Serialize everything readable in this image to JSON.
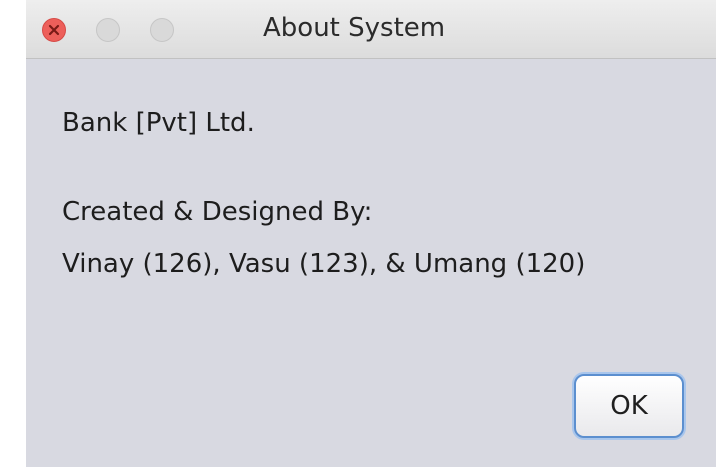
{
  "window": {
    "title": "About System"
  },
  "titlebar_buttons": {
    "close_icon": "close-icon",
    "minimize_icon": "minimize-icon",
    "maximize_icon": "zoom-icon"
  },
  "content": {
    "company": "Bank [Pvt] Ltd.",
    "credits_heading": "Created & Designed By:",
    "credits_names": "Vinay (126), Vasu (123), & Umang (120)"
  },
  "buttons": {
    "ok_label": "OK"
  },
  "colors": {
    "window_background": "#d8d9e1",
    "close_button": "#ed5f5a",
    "focus_ring": "#5c8fcf"
  }
}
